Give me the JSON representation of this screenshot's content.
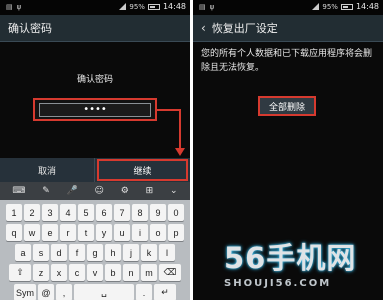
{
  "status_bar": {
    "left_icons": [
      "sim-icon",
      "usb-icon"
    ],
    "signal": "95%",
    "time": "14:48"
  },
  "left_screen": {
    "title": "确认密码",
    "prompt": "确认密码",
    "password_value": "••••",
    "cancel_label": "取消",
    "continue_label": "继续",
    "keyboard": {
      "tools": [
        "⌨",
        "✎",
        "🎤",
        "☺",
        "⚙",
        "⊞",
        "⌄"
      ],
      "row1": [
        "1",
        "2",
        "3",
        "4",
        "5",
        "6",
        "7",
        "8",
        "9",
        "0"
      ],
      "row2": [
        "q",
        "w",
        "e",
        "r",
        "t",
        "y",
        "u",
        "i",
        "o",
        "p"
      ],
      "row3": [
        "a",
        "s",
        "d",
        "f",
        "g",
        "h",
        "j",
        "k",
        "l"
      ],
      "row4": [
        "⇧",
        "z",
        "x",
        "c",
        "v",
        "b",
        "n",
        "m",
        "⌫"
      ],
      "row5": [
        "Sym",
        "@",
        ",",
        "␣",
        ".",
        "↵"
      ]
    }
  },
  "right_screen": {
    "title": "恢复出厂设定",
    "warning": "您的所有个人数据和已下载应用程序将会删除且无法恢复。",
    "reset_label": "全部删除"
  },
  "watermark": {
    "logo": "56手机网",
    "url": "SHOUJI56.COM"
  },
  "colors": {
    "highlight": "#d63a2f",
    "titlebar": "#222d33",
    "screen_bg": "#0a0a0a"
  }
}
